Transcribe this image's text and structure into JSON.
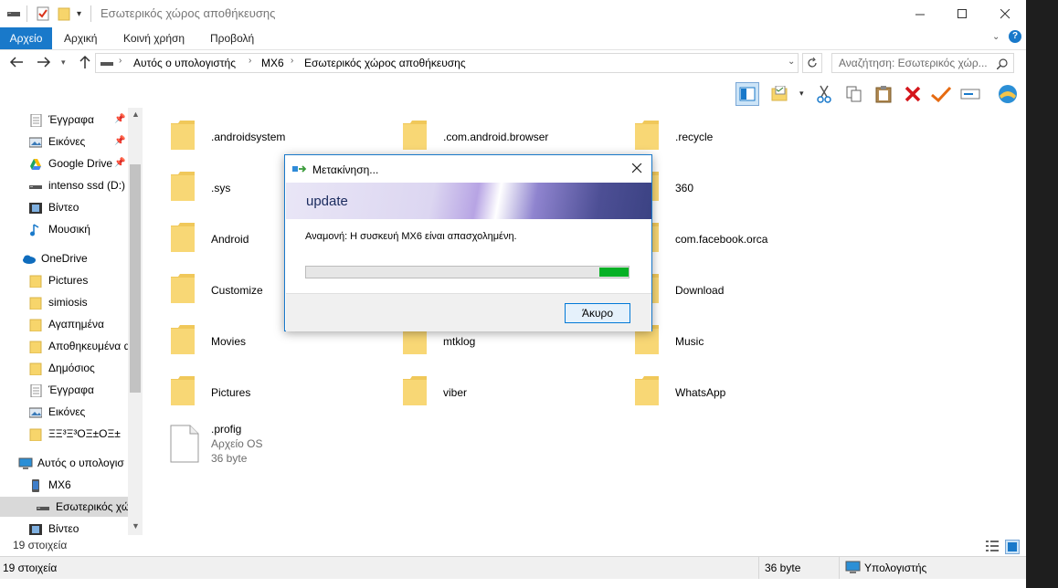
{
  "window": {
    "title": "Εσωτερικός χώρος αποθήκευσης"
  },
  "ribbon": {
    "tabs": [
      "Αρχείο",
      "Αρχική",
      "Κοινή χρήση",
      "Προβολή"
    ]
  },
  "address": {
    "crumbs": [
      "Αυτός ο υπολογιστής",
      "MX6",
      "Εσωτερικός χώρος αποθήκευσης"
    ]
  },
  "search": {
    "placeholder": "Αναζήτηση: Εσωτερικός χώρ..."
  },
  "nav": {
    "items": [
      {
        "label": "Έγγραφα",
        "icon": "documents-icon",
        "pinned": true
      },
      {
        "label": "Εικόνες",
        "icon": "pictures-icon",
        "pinned": true
      },
      {
        "label": "Google Drive",
        "icon": "google-drive-icon",
        "pinned": true
      },
      {
        "label": "intenso ssd (D:)",
        "icon": "drive-icon",
        "pinned": false
      },
      {
        "label": "Βίντεο",
        "icon": "video-icon",
        "pinned": false
      },
      {
        "label": "Μουσική",
        "icon": "music-icon",
        "pinned": false
      },
      {
        "label": "OneDrive",
        "icon": "onedrive-icon",
        "pinned": false
      },
      {
        "label": "Pictures",
        "icon": "folder-icon",
        "pinned": false
      },
      {
        "label": "simiosis",
        "icon": "folder-icon",
        "pinned": false
      },
      {
        "label": "Αγαπημένα",
        "icon": "folder-icon",
        "pinned": false
      },
      {
        "label": "Αποθηκευμένα α",
        "icon": "folder-icon",
        "pinned": false
      },
      {
        "label": "Δημόσιος",
        "icon": "folder-icon",
        "pinned": false
      },
      {
        "label": "Έγγραφα",
        "icon": "documents-icon",
        "pinned": false
      },
      {
        "label": "Εικόνες",
        "icon": "pictures-icon",
        "pinned": false
      },
      {
        "label": "ΞΞ³Ξ³ΟΞ±ΟΞ±",
        "icon": "folder-icon",
        "pinned": false
      },
      {
        "label": "Αυτός ο υπολογισ",
        "icon": "computer-icon",
        "pinned": false
      },
      {
        "label": "MX6",
        "icon": "phone-icon",
        "pinned": false
      },
      {
        "label": "Εσωτερικός χώ",
        "icon": "drive-icon",
        "pinned": false
      },
      {
        "label": "Βίντεο",
        "icon": "video-icon",
        "pinned": false
      }
    ]
  },
  "files": [
    {
      "name": ".androidsystem"
    },
    {
      "name": ".com.android.browser"
    },
    {
      "name": ".recycle"
    },
    {
      "name": ".sys"
    },
    {
      "name": ""
    },
    {
      "name": "360"
    },
    {
      "name": "Android"
    },
    {
      "name": ""
    },
    {
      "name": "com.facebook.orca"
    },
    {
      "name": "Customize"
    },
    {
      "name": ""
    },
    {
      "name": "Download"
    },
    {
      "name": "Movies"
    },
    {
      "name": "mtklog"
    },
    {
      "name": "Music"
    },
    {
      "name": "Pictures"
    },
    {
      "name": "viber"
    },
    {
      "name": "WhatsApp"
    }
  ],
  "file_item": {
    "name": ".profig",
    "type": "Αρχείο OS",
    "size": "36 byte"
  },
  "status": {
    "count": "19 στοιχεία"
  },
  "bottom_status": {
    "count": "19 στοιχεία",
    "size": "36 byte",
    "location": "Υπολογιστής"
  },
  "dialog": {
    "title": "Μετακίνηση...",
    "heading": "update",
    "message": "Αναμονή: Η συσκευή MX6 είναι απασχολημένη.",
    "progress": 0.09,
    "cancel_label": "Άκυρο"
  }
}
